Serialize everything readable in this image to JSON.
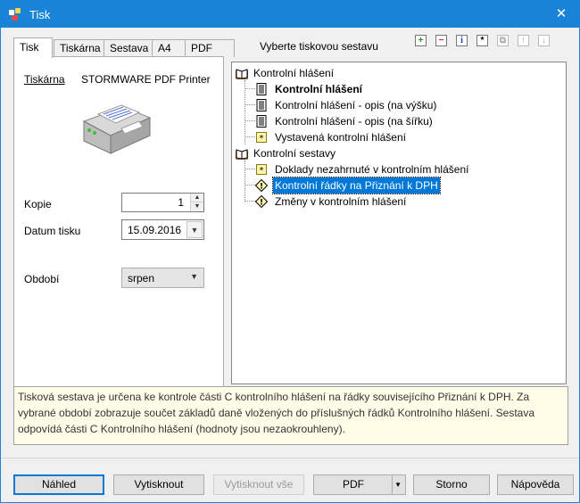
{
  "window": {
    "title": "Tisk",
    "close": "✕",
    "accent": "#1883d7"
  },
  "tabs": [
    {
      "label": "Tisk"
    },
    {
      "label": "Tiskárna"
    },
    {
      "label": "Sestava"
    },
    {
      "label": "A4"
    },
    {
      "label": "PDF"
    }
  ],
  "settings": {
    "printer_label": "Tiskárna",
    "printer_value": "STORMWARE PDF Printer",
    "copies_label": "Kopie",
    "copies_value": "1",
    "date_label": "Datum tisku",
    "date_value": "15.09.2016",
    "period_label": "Období",
    "period_value": "srpen"
  },
  "tree": {
    "heading": "Vyberte tiskovou sestavu",
    "toolbar_icons": [
      "add-icon",
      "remove-icon",
      "info-icon",
      "star-icon",
      "copy-icon",
      "move-up-icon",
      "move-down-icon"
    ],
    "groups": [
      {
        "label": "Kontrolní hlášení",
        "items": [
          {
            "label": "Kontrolní hlášení",
            "icon": "document-icon",
            "bold": true
          },
          {
            "label": "Kontrolní hlášení - opis (na výšku)",
            "icon": "document-icon"
          },
          {
            "label": "Kontrolní hlášení - opis (na šířku)",
            "icon": "document-icon"
          },
          {
            "label": "Vystavená kontrolní hlášení",
            "icon": "star-doc-icon"
          }
        ]
      },
      {
        "label": "Kontrolní sestavy",
        "items": [
          {
            "label": "Doklady nezahrnuté v kontrolním hlášení",
            "icon": "star-doc-icon"
          },
          {
            "label": "Kontrolní řádky na Přiznání k DPH",
            "icon": "warning-icon",
            "selected": true
          },
          {
            "label": "Změny v kontrolním hlášení",
            "icon": "warning-icon"
          }
        ]
      }
    ]
  },
  "description": "Tisková sestava je určena ke kontrole části C kontrolního hlášení na řádky souvisejícího Přiznání k DPH. Za vybrané období zobrazuje součet základů daně vložených do příslušných řádků Kontrolního hlášení. Sestava odpovídá části C Kontrolního hlášení (hodnoty jsou nezaokrouhleny).",
  "buttons": {
    "preview": "Náhled",
    "print": "Vytisknout",
    "print_all": "Vytisknout vše",
    "pdf": "PDF",
    "cancel": "Storno",
    "help": "Nápověda"
  }
}
